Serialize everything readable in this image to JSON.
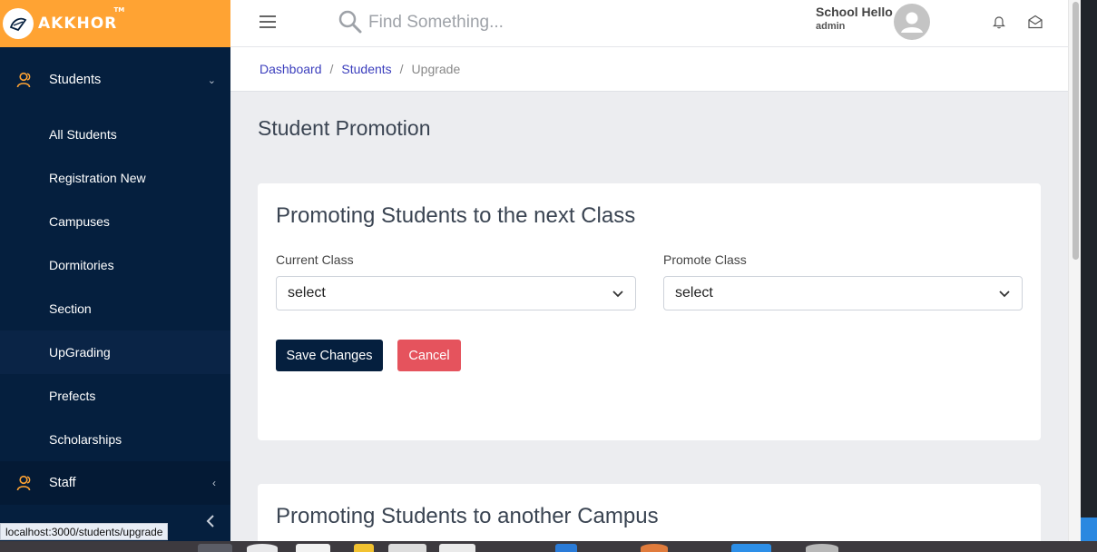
{
  "brand": {
    "name": "AKKHOR",
    "trademark": "TM"
  },
  "sidebar": {
    "students_label": "Students",
    "items": [
      {
        "label": "All Students"
      },
      {
        "label": "Registration New"
      },
      {
        "label": "Campuses"
      },
      {
        "label": "Dormitories"
      },
      {
        "label": "Section"
      },
      {
        "label": "UpGrading"
      },
      {
        "label": "Prefects"
      },
      {
        "label": "Scholarships"
      }
    ],
    "staff_label": "Staff",
    "active_item": "UpGrading"
  },
  "header": {
    "search_placeholder": "Find Something...",
    "user_name": "School Hello",
    "user_role": "admin"
  },
  "breadcrumb": {
    "items": [
      "Dashboard",
      "Students"
    ],
    "current": "Upgrade",
    "separator": "/"
  },
  "page": {
    "title": "Student Promotion",
    "card1": {
      "title": "Promoting Students to the next Class",
      "current_class_label": "Current Class",
      "current_class_value": "select",
      "promote_class_label": "Promote Class",
      "promote_class_value": "select",
      "save_label": "Save Changes",
      "cancel_label": "Cancel"
    },
    "card2": {
      "title": "Promoting Students to another Campus"
    }
  },
  "status_url": "localhost:3000/students/upgrade",
  "colors": {
    "brand_orange": "#ffa333",
    "sidebar_bg": "#051f3e",
    "accent_icon": "#ffa333",
    "link_blue": "#3b3ebd",
    "save_button": "#051f3e",
    "cancel_button": "#e5535d"
  }
}
